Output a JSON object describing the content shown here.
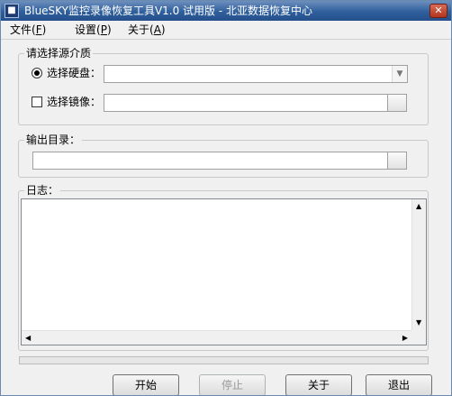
{
  "window": {
    "title": "BlueSKY监控录像恢复工具V1.0 试用版 - 北亚数据恢复中心",
    "close_glyph": "✕",
    "icon_glyph": "■"
  },
  "menu": {
    "file": {
      "label": "文件(",
      "key": "F",
      "end": ")"
    },
    "settings": {
      "label": "设置(",
      "key": "P",
      "end": ")"
    },
    "about": {
      "label": "关于(",
      "key": "A",
      "end": ")"
    }
  },
  "source": {
    "group_title": "请选择源介质",
    "disk_label": "选择硬盘：",
    "disk_value": "",
    "disk_selected": true,
    "image_label": "选择镜像：",
    "image_value": "",
    "image_checked": false
  },
  "output": {
    "group_title": "输出目录：",
    "path_value": ""
  },
  "log": {
    "group_title": "日志：",
    "content": ""
  },
  "progress": {
    "value": 0
  },
  "buttons": {
    "start": "开始",
    "stop": "停止",
    "about": "关于",
    "exit": "退出"
  },
  "icons": {
    "combo_arrow": "▼",
    "scroll_up": "▲",
    "scroll_down": "▼",
    "scroll_left": "◀",
    "scroll_right": "▶"
  },
  "colors": {
    "titlebar": "#2f5f9c",
    "window_bg": "#f0f0f0"
  }
}
